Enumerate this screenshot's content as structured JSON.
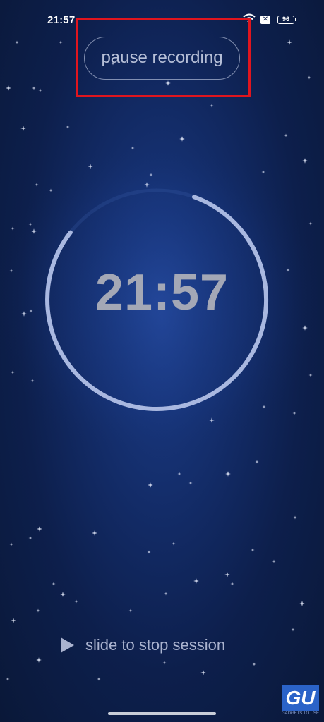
{
  "status_bar": {
    "time": "21:57",
    "icons": [
      "wifi-icon",
      "sim-x-icon",
      "battery-icon"
    ],
    "sim_symbol": "✕",
    "battery_level": "96"
  },
  "header": {
    "pause_button_label": "pause recording"
  },
  "timer": {
    "display": "21:57",
    "progress": 0.8
  },
  "footer": {
    "slide_label": "slide to stop session",
    "slide_icon": "play-icon"
  },
  "watermark": {
    "logo": "GU",
    "text": "GADGETS TO USE"
  },
  "colors": {
    "background": "#122a64",
    "ring": "#a9b8e0",
    "timer_text": "#a4a8b6",
    "highlight": "#e0151e"
  }
}
